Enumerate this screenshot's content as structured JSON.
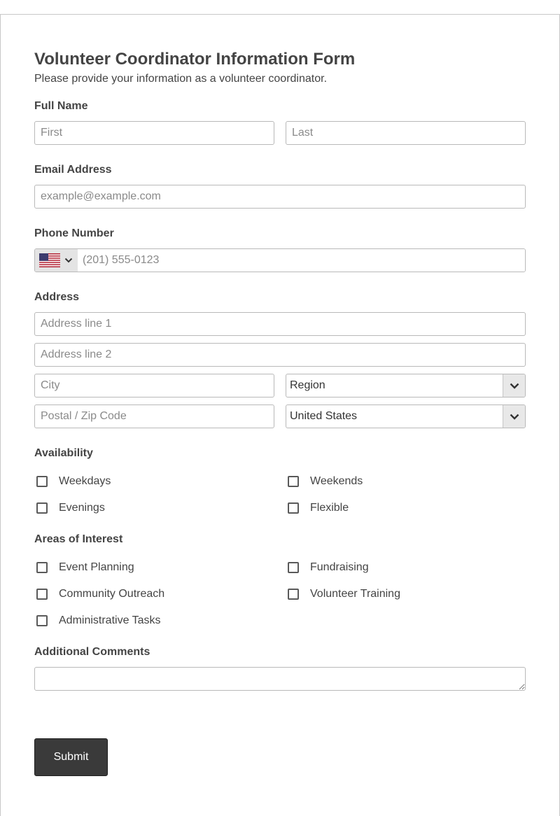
{
  "form": {
    "title": "Volunteer Coordinator Information Form",
    "subtitle": "Please provide your information as a volunteer coordinator."
  },
  "full_name": {
    "label": "Full Name",
    "first_placeholder": "First",
    "last_placeholder": "Last"
  },
  "email": {
    "label": "Email Address",
    "placeholder": "example@example.com"
  },
  "phone": {
    "label": "Phone Number",
    "country_icon": "us-flag-icon",
    "placeholder": "(201) 555-0123"
  },
  "address": {
    "label": "Address",
    "line1_placeholder": "Address line 1",
    "line2_placeholder": "Address line 2",
    "city_placeholder": "City",
    "region_value": "Region",
    "postal_placeholder": "Postal / Zip Code",
    "country_value": "United States"
  },
  "availability": {
    "label": "Availability",
    "options": [
      "Weekdays",
      "Weekends",
      "Evenings",
      "Flexible"
    ]
  },
  "interests": {
    "label": "Areas of Interest",
    "options": [
      "Event Planning",
      "Fundraising",
      "Community Outreach",
      "Volunteer Training",
      "Administrative Tasks"
    ]
  },
  "comments": {
    "label": "Additional Comments",
    "value": ""
  },
  "submit": {
    "label": "Submit"
  },
  "colors": {
    "button_bg": "#3a3a3a",
    "border": "#b9b9b9",
    "text": "#444444"
  }
}
